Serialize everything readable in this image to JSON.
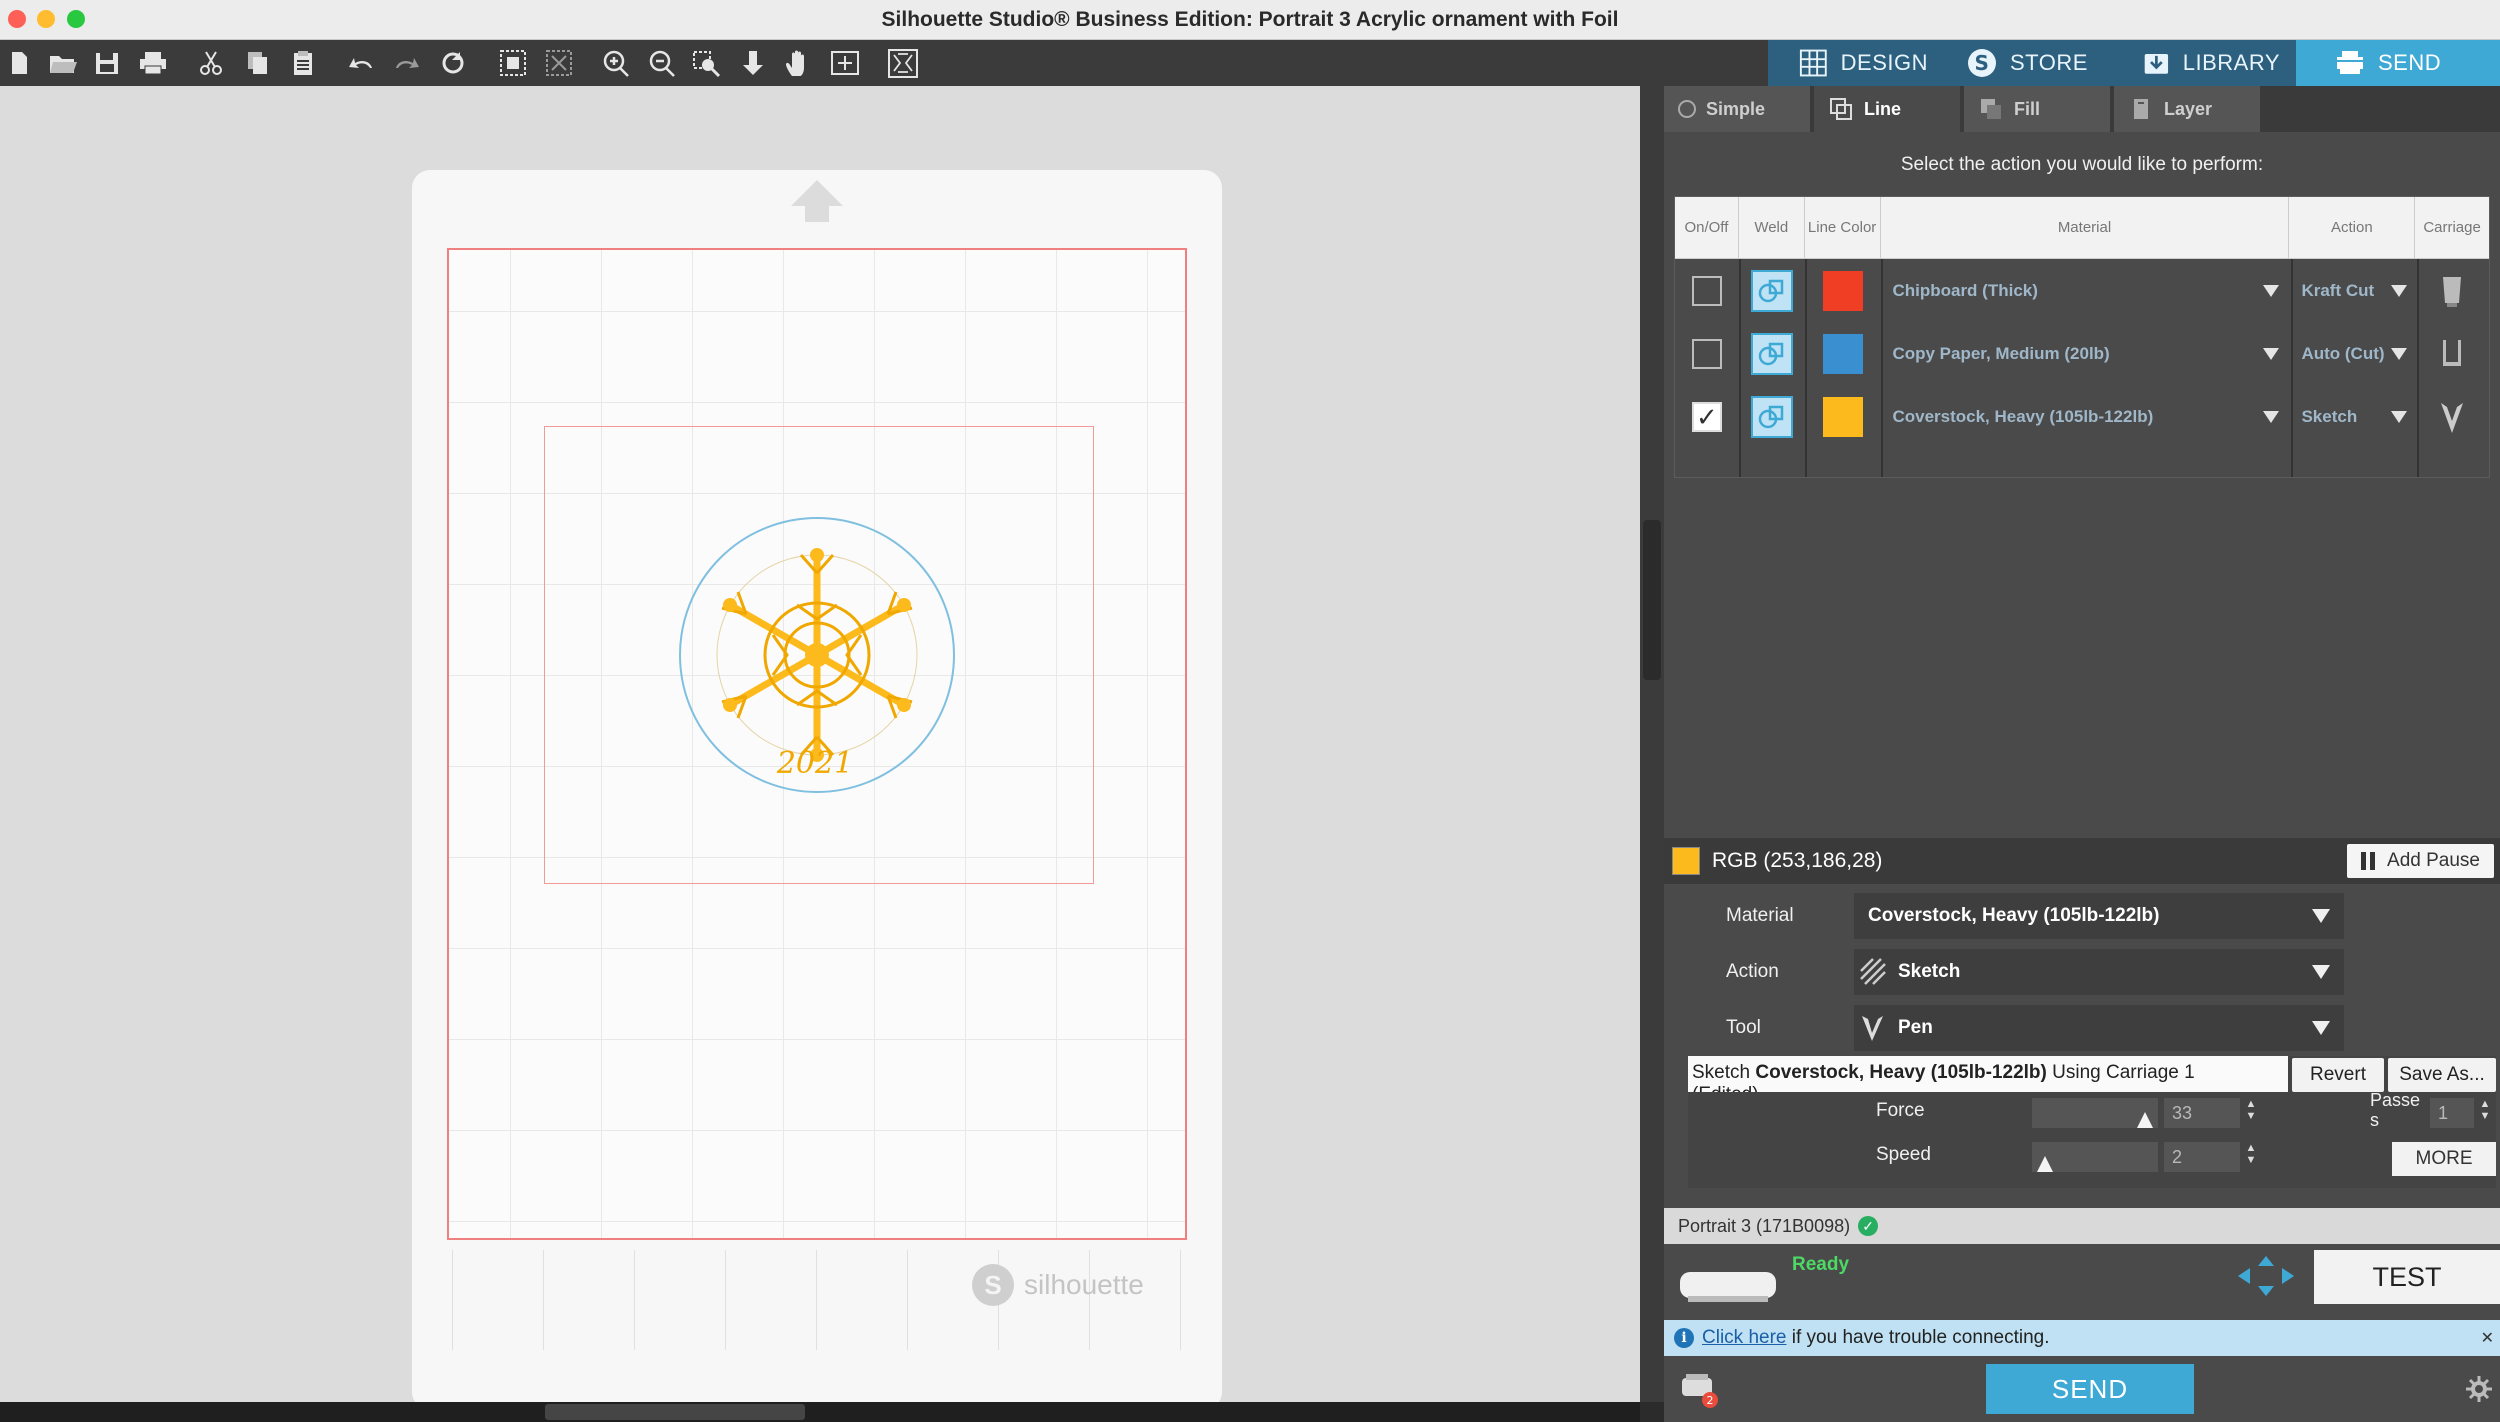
{
  "window": {
    "title": "Silhouette Studio® Business Edition: Portrait 3 Acrylic ornament with Foil"
  },
  "nav": {
    "design": "DESIGN",
    "store": "STORE",
    "library": "LIBRARY",
    "send": "SEND"
  },
  "subtabs": {
    "simple": "Simple",
    "line": "Line",
    "fill": "Fill",
    "layer": "Layer"
  },
  "prompt": "Select the action you would like to perform:",
  "table": {
    "headers": {
      "onoff": "On/Off",
      "weld": "Weld",
      "line_color": "Line Color",
      "material": "Material",
      "action": "Action",
      "carriage": "Carriage"
    },
    "rows": [
      {
        "checked": false,
        "color": "#f03e24",
        "material": "Chipboard (Thick)",
        "action": "Kraft Cut"
      },
      {
        "checked": false,
        "color": "#3a8fd0",
        "material": "Copy Paper, Medium (20lb)",
        "action": "Auto (Cut)"
      },
      {
        "checked": true,
        "color": "#fdba1c",
        "material": "Coverstock, Heavy (105lb-122lb)",
        "action": "Sketch"
      }
    ]
  },
  "selected": {
    "rgb_label": "RGB (253,186,28)",
    "add_pause": "Add Pause",
    "material_label": "Material",
    "material_value": "Coverstock, Heavy (105lb-122lb)",
    "action_label": "Action",
    "action_value": "Sketch",
    "tool_label": "Tool",
    "tool_value": "Pen"
  },
  "preset": {
    "prefix": "Sketch ",
    "material": "Coverstock, Heavy (105lb-122lb)",
    "suffix": " Using Carriage 1",
    "edited": "(Edited)",
    "revert": "Revert",
    "save_as": "Save As...",
    "force_label": "Force",
    "force_value": "33",
    "force_level": 0.9,
    "speed_label": "Speed",
    "speed_value": "2",
    "speed_level": 0.1,
    "passes_label_1": "Passe",
    "passes_label_2": "s",
    "passes_value": "1",
    "more": "MORE"
  },
  "device": {
    "name": "Portrait 3 (171B0098)",
    "status": "Ready",
    "test": "TEST"
  },
  "info": {
    "link": "Click here",
    "text": " if you have trouble connecting."
  },
  "send_button": "SEND",
  "canvas": {
    "brand": "silhouette",
    "ornament_year": "2021"
  },
  "colors": {
    "accent": "#3fa9d6",
    "cut_line": "#f07f7f",
    "ornament": "#fdba1c"
  }
}
